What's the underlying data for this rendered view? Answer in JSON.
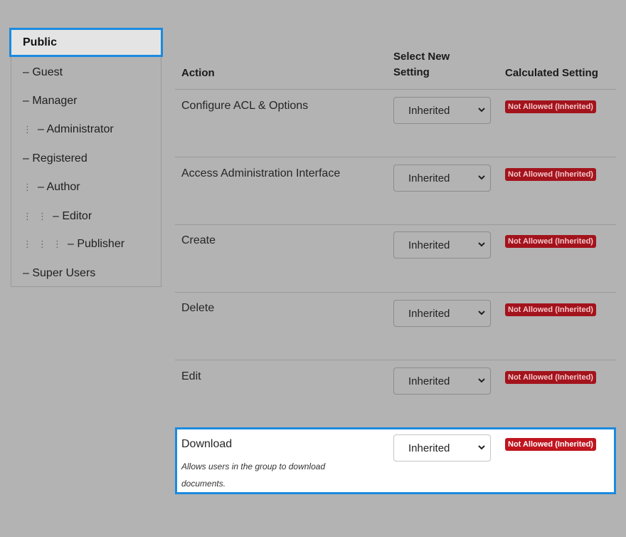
{
  "groups": {
    "public": "Public",
    "items": [
      {
        "label": "– Guest",
        "depth": 0
      },
      {
        "label": "– Manager",
        "depth": 0
      },
      {
        "label": "– Administrator",
        "depth": 1
      },
      {
        "label": "– Registered",
        "depth": 0
      },
      {
        "label": "– Author",
        "depth": 1
      },
      {
        "label": "– Editor",
        "depth": 2
      },
      {
        "label": "– Publisher",
        "depth": 3
      },
      {
        "label": "– Super Users",
        "depth": 0
      }
    ],
    "depth_marker": "⋮"
  },
  "table": {
    "headers": {
      "action": "Action",
      "select_new_line1": "Select New",
      "select_new_line2": "Setting",
      "calculated": "Calculated Setting"
    },
    "rows": [
      {
        "action": "Configure ACL & Options",
        "setting": "Inherited",
        "calculated": "Not Allowed (Inherited)"
      },
      {
        "action": "Access Administration Interface",
        "setting": "Inherited",
        "calculated": "Not Allowed (Inherited)"
      },
      {
        "action": "Create",
        "setting": "Inherited",
        "calculated": "Not Allowed (Inherited)"
      },
      {
        "action": "Delete",
        "setting": "Inherited",
        "calculated": "Not Allowed (Inherited)"
      },
      {
        "action": "Edit",
        "setting": "Inherited",
        "calculated": "Not Allowed (Inherited)"
      },
      {
        "action": "Download",
        "setting": "Inherited",
        "calculated": "Not Allowed (Inherited)",
        "description": "Allows users in the group to download documents."
      }
    ]
  },
  "colors": {
    "highlight": "#1b8ae0",
    "badge": "#a3131c",
    "background": "#b3b3b3"
  }
}
